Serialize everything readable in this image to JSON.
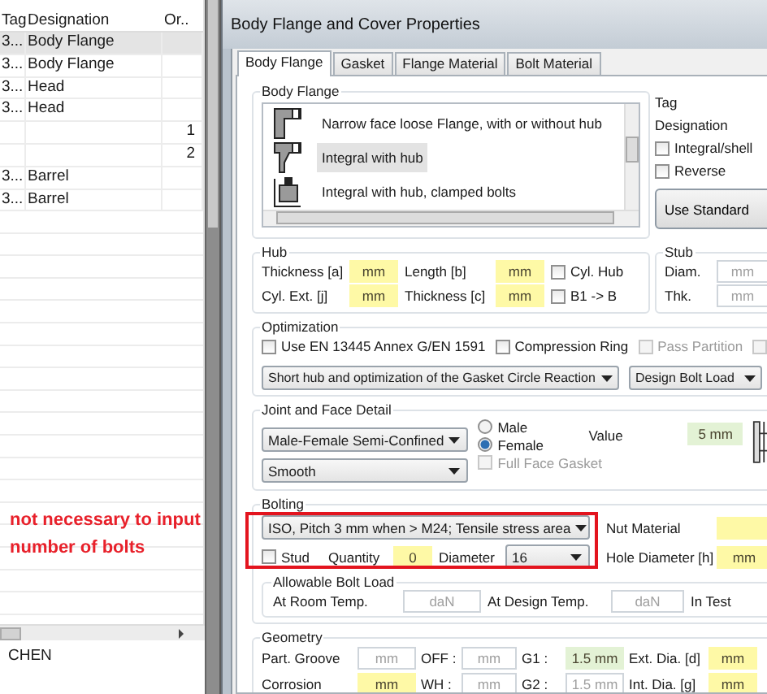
{
  "table": {
    "columns": [
      "Tag",
      "Designation",
      "Or.."
    ],
    "rows": [
      {
        "tag": "3...",
        "designation": "Body Flange",
        "selected": true
      },
      {
        "tag": "3...",
        "designation": "Body Flange",
        "selected": false
      },
      {
        "tag": "3...",
        "designation": "Head",
        "selected": false
      },
      {
        "tag": "3...",
        "designation": "Head",
        "selected": false
      },
      {
        "order": "1",
        "selected": false
      },
      {
        "order": "2",
        "selected": false
      },
      {
        "tag": "3...",
        "designation": "Barrel",
        "selected": false
      },
      {
        "tag": "3...",
        "designation": "Barrel",
        "selected": false
      }
    ]
  },
  "status_text": "CHEN",
  "annotation": "not necessary to input number of bolts",
  "dialog": {
    "title": "Body Flange and Cover Properties",
    "tabs": [
      {
        "label": "Body Flange",
        "selected": true
      },
      {
        "label": "Gasket",
        "selected": false
      },
      {
        "label": "Flange Material",
        "selected": false
      },
      {
        "label": "Bolt Material",
        "selected": false
      }
    ],
    "groups": [
      [
        {
          "kind": "listbox",
          "label": "Body Flange",
          "items": [
            {
              "label": "Narrow face loose Flange, with or without hub",
              "selected": false
            },
            {
              "label": "Integral with hub",
              "selected": true
            },
            {
              "label": "Integral with hub, clamped bolts",
              "selected": false
            }
          ]
        },
        {
          "kind": "side",
          "labels": [
            "Tag",
            "Designation"
          ],
          "checks": [
            {
              "kind": "check",
              "label": "Integral/shell",
              "checked": false,
              "disabled": false
            },
            {
              "kind": "check",
              "label": "Reverse",
              "checked": false,
              "disabled": false
            }
          ],
          "button": "Use Standard"
        }
      ],
      [
        {
          "kind": "hub",
          "label": "Hub",
          "rows": [
            [
              {
                "kind": "label",
                "text": "Thickness [a]"
              },
              {
                "kind": "field",
                "value": "mm",
                "color": "#fef9a6"
              },
              {
                "kind": "label",
                "text": "Length [b]"
              },
              {
                "kind": "field",
                "value": "mm",
                "color": "#fef9a6"
              },
              {
                "kind": "check",
                "label": "Cyl. Hub",
                "checked": false,
                "disabled": false
              }
            ],
            [
              {
                "kind": "label",
                "text": "Cyl. Ext. [j]"
              },
              {
                "kind": "field",
                "value": "mm",
                "color": "#fef9a6"
              },
              {
                "kind": "label",
                "text": "Thickness [c]"
              },
              {
                "kind": "field",
                "value": "mm",
                "color": "#fef9a6"
              },
              {
                "kind": "check",
                "label": "B1 -> B",
                "checked": false,
                "disabled": false
              }
            ]
          ]
        },
        {
          "kind": "stub",
          "label": "Stub",
          "rows": [
            [
              {
                "kind": "label",
                "text": "Diam."
              },
              {
                "kind": "field",
                "placeholder": "mm",
                "color": "#ffffff"
              }
            ],
            [
              {
                "kind": "label",
                "text": "Thk."
              },
              {
                "kind": "field",
                "placeholder": "mm",
                "color": "#ffffff"
              }
            ]
          ]
        }
      ],
      [
        {
          "kind": "optimization",
          "label": "Optimization",
          "lines": [
            {
              "items": [
                {
                  "kind": "check",
                  "label": "Use EN 13445 Annex G/EN 1591",
                  "checked": false,
                  "disabled": false
                },
                {
                  "kind": "check",
                  "label": "Compression Ring",
                  "checked": false,
                  "disabled": false
                },
                {
                  "kind": "check",
                  "label": "Pass Partition",
                  "checked": false,
                  "disabled": true
                },
                {
                  "kind": "check",
                  "checked": false,
                  "disabled": true
                }
              ]
            },
            {
              "items": [
                {
                  "kind": "dropdown",
                  "value": "Short hub and optimization of the Gasket Circle Reaction"
                },
                {
                  "kind": "dropdown",
                  "value": "Design Bolt Load"
                }
              ]
            }
          ]
        }
      ],
      [
        {
          "kind": "joint",
          "label": "Joint and Face Detail",
          "columns": [
            [
              {
                "kind": "dropdown",
                "value": "Male-Female Semi-Confined"
              },
              {
                "kind": "dropdown",
                "value": "Smooth"
              }
            ],
            [
              {
                "kind": "radio",
                "label": "Male",
                "selected": false
              },
              {
                "kind": "radio",
                "label": "Female",
                "selected": true
              },
              {
                "kind": "check",
                "label": "Full Face Gasket",
                "checked": false,
                "disabled": true
              }
            ],
            [
              {
                "kind": "label",
                "text": "Value"
              }
            ],
            [
              {
                "kind": "field",
                "value": "5 mm",
                "color": "#e3f2d5"
              }
            ]
          ]
        }
      ],
      [
        {
          "kind": "bolting",
          "label": "Bolting",
          "lines": [
            {
              "items": [
                {
                  "kind": "dropdown",
                  "value": "ISO, Pitch 3 mm when > M24; Tensile stress area"
                },
                {
                  "kind": "label",
                  "text": "Nut Material"
                },
                {
                  "kind": "field",
                  "color": "#fef9a6"
                }
              ]
            },
            {
              "items": [
                {
                  "kind": "check",
                  "label": "Stud",
                  "checked": false,
                  "disabled": false
                },
                {
                  "kind": "label",
                  "text": "Quantity"
                },
                {
                  "kind": "field",
                  "value": "0",
                  "color": "#fef9a6"
                },
                {
                  "kind": "label",
                  "text": "Diameter"
                },
                {
                  "kind": "dropdown",
                  "value": "16"
                },
                {
                  "kind": "label",
                  "text": "Hole Diameter [h]"
                },
                {
                  "kind": "field",
                  "value": "mm",
                  "color": "#fef9a6"
                }
              ]
            }
          ],
          "groups": [
            {
              "kind": "allowable",
              "label": "Allowable Bolt Load",
              "rows": [
                [
                  {
                    "kind": "label",
                    "text": "At Room Temp."
                  },
                  {
                    "kind": "field",
                    "placeholder": "daN",
                    "color": "#ffffff"
                  },
                  {
                    "kind": "label",
                    "text": "At Design Temp."
                  },
                  {
                    "kind": "field",
                    "placeholder": "daN",
                    "color": "#ffffff"
                  },
                  {
                    "kind": "label",
                    "text": "In Test"
                  }
                ]
              ]
            }
          ]
        }
      ],
      [
        {
          "kind": "geometry",
          "label": "Geometry",
          "rows": [
            [
              {
                "kind": "label",
                "text": "Part. Groove"
              },
              {
                "kind": "field",
                "placeholder": "mm",
                "color": "#ffffff"
              },
              {
                "kind": "label",
                "text": "OFF :"
              },
              {
                "kind": "field",
                "placeholder": "mm",
                "color": "#ffffff"
              },
              {
                "kind": "label",
                "text": "G1 :"
              },
              {
                "kind": "field",
                "value": "1.5 mm",
                "color": "#e3f2d5"
              },
              {
                "kind": "label",
                "text": "Ext. Dia. [d]"
              },
              {
                "kind": "field",
                "value": "mm",
                "color": "#fef9a6"
              }
            ],
            [
              {
                "kind": "label",
                "text": "Corrosion"
              },
              {
                "kind": "field",
                "value": "mm",
                "color": "#fef9a6"
              },
              {
                "kind": "label",
                "text": "WH :"
              },
              {
                "kind": "field",
                "placeholder": "mm",
                "color": "#ffffff"
              },
              {
                "kind": "label",
                "text": "G2 :"
              },
              {
                "kind": "field",
                "placeholder": "1.5 mm",
                "color": "#ffffff"
              },
              {
                "kind": "label",
                "text": "Int. Dia. [g]"
              },
              {
                "kind": "field",
                "value": "mm",
                "color": "#fef9a6"
              }
            ]
          ]
        }
      ]
    ]
  }
}
